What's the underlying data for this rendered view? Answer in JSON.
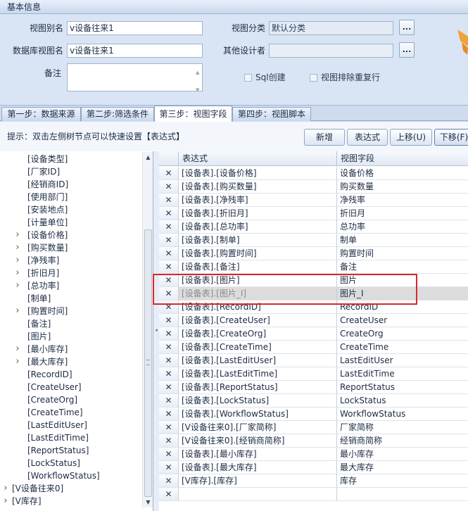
{
  "info": {
    "header": "基本信息",
    "view_alias_label": "视图别名",
    "view_alias_value": "v设备往来1",
    "db_view_label": "数据库视图名",
    "db_view_value": "v设备往来1",
    "remark_label": "备注",
    "category_label": "视图分类",
    "category_value": "默认分类",
    "other_designer_label": "其他设计者",
    "dots": "...",
    "sql_create_label": "Sql创建",
    "dedupe_label": "视图排除重复行"
  },
  "tabs": [
    {
      "label": "第一步：数据来源"
    },
    {
      "label": "第二步:筛选条件"
    },
    {
      "label": "第三步：视图字段"
    },
    {
      "label": "第四步：视图脚本"
    }
  ],
  "toolbar": {
    "hint": "提示：双击左侧树节点可以快速设置【表达式】",
    "new_label": "新增",
    "expr_label": "表达式",
    "up_label": "上移(U)",
    "down_label": "下移(F)"
  },
  "tree": {
    "items": [
      {
        "label": "[设备类型]",
        "arrow": false
      },
      {
        "label": "[厂家ID]",
        "arrow": false
      },
      {
        "label": "[经销商ID]",
        "arrow": false
      },
      {
        "label": "[使用部门]",
        "arrow": false
      },
      {
        "label": "[安装地点]",
        "arrow": false
      },
      {
        "label": "[计量单位]",
        "arrow": false
      },
      {
        "label": "[设备价格]",
        "arrow": true
      },
      {
        "label": "[购买数量]",
        "arrow": true
      },
      {
        "label": "[净残率]",
        "arrow": true
      },
      {
        "label": "[折旧月]",
        "arrow": true
      },
      {
        "label": "[总功率]",
        "arrow": true
      },
      {
        "label": "[制单]",
        "arrow": false
      },
      {
        "label": "[购置时间]",
        "arrow": true
      },
      {
        "label": "[备注]",
        "arrow": false
      },
      {
        "label": "[图片]",
        "arrow": false
      },
      {
        "label": "[最小库存]",
        "arrow": true
      },
      {
        "label": "[最大库存]",
        "arrow": true
      },
      {
        "label": "[RecordID]",
        "arrow": false
      },
      {
        "label": "[CreateUser]",
        "arrow": false
      },
      {
        "label": "[CreateOrg]",
        "arrow": false
      },
      {
        "label": "[CreateTime]",
        "arrow": false
      },
      {
        "label": "[LastEditUser]",
        "arrow": false
      },
      {
        "label": "[LastEditTime]",
        "arrow": false
      },
      {
        "label": "[ReportStatus]",
        "arrow": false
      },
      {
        "label": "[LockStatus]",
        "arrow": false
      },
      {
        "label": "[WorkflowStatus]",
        "arrow": false
      }
    ],
    "roots": [
      {
        "label": "[V设备往来0]"
      },
      {
        "label": "[V库存]"
      }
    ]
  },
  "grid": {
    "col_expr": "表达式",
    "col_field": "视图字段",
    "delete_glyph": "✕",
    "rows": [
      {
        "expr": "[设备表].[设备价格]",
        "field": "设备价格"
      },
      {
        "expr": "[设备表].[购买数量]",
        "field": "购买数量"
      },
      {
        "expr": "[设备表].[净残率]",
        "field": "净残率"
      },
      {
        "expr": "[设备表].[折旧月]",
        "field": "折旧月"
      },
      {
        "expr": "[设备表].[总功率]",
        "field": "总功率"
      },
      {
        "expr": "[设备表].[制单]",
        "field": "制单"
      },
      {
        "expr": "[设备表].[购置时间]",
        "field": "购置时间"
      },
      {
        "expr": "[设备表].[备注]",
        "field": "备注"
      },
      {
        "expr": "[设备表].[图片]",
        "field": "图片"
      },
      {
        "expr": "[设备表].[图片_I]",
        "field": "图片_I"
      },
      {
        "expr": "[设备表].[RecordID]",
        "field": "RecordID"
      },
      {
        "expr": "[设备表].[CreateUser]",
        "field": "CreateUser"
      },
      {
        "expr": "[设备表].[CreateOrg]",
        "field": "CreateOrg"
      },
      {
        "expr": "[设备表].[CreateTime]",
        "field": "CreateTime"
      },
      {
        "expr": "[设备表].[LastEditUser]",
        "field": "LastEditUser"
      },
      {
        "expr": "[设备表].[LastEditTime]",
        "field": "LastEditTime"
      },
      {
        "expr": "[设备表].[ReportStatus]",
        "field": "ReportStatus"
      },
      {
        "expr": "[设备表].[LockStatus]",
        "field": "LockStatus"
      },
      {
        "expr": "[设备表].[WorkflowStatus]",
        "field": "WorkflowStatus"
      },
      {
        "expr": "[V设备往来0].[厂家简称]",
        "field": "厂家简称"
      },
      {
        "expr": "[V设备往来0].[经销商简称]",
        "field": "经销商简称"
      },
      {
        "expr": "[设备表].[最小库存]",
        "field": "最小库存"
      },
      {
        "expr": "[设备表].[最大库存]",
        "field": "最大库存"
      },
      {
        "expr": "[V库存].[库存]",
        "field": "库存"
      },
      {
        "expr": "",
        "field": ""
      }
    ]
  }
}
